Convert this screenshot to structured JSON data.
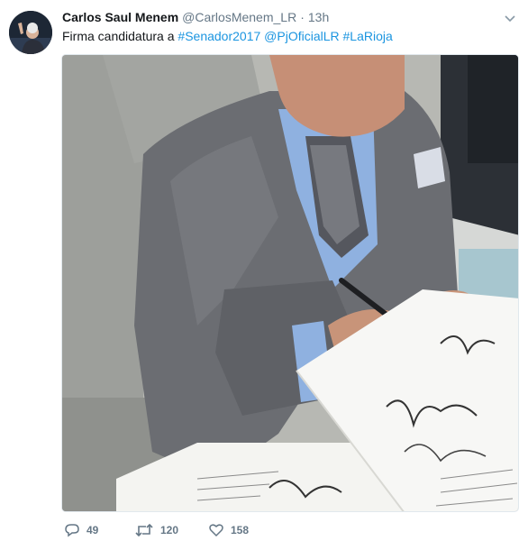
{
  "tweet": {
    "author_name": "Carlos Saul Menem",
    "handle": "@CarlosMenem_LR",
    "time_separator": "·",
    "timestamp": "13h",
    "text_prefix": "Firma candidatura a",
    "hashtags": [
      "#Senador2017",
      "@PjOficialLR",
      "#LaRioja"
    ],
    "media_icon": "photo",
    "reply_count": "49",
    "retweet_count": "120",
    "like_count": "158"
  },
  "colors": {
    "link": "#1b95e0",
    "secondary_text": "#657786",
    "primary_text": "#14171a"
  }
}
